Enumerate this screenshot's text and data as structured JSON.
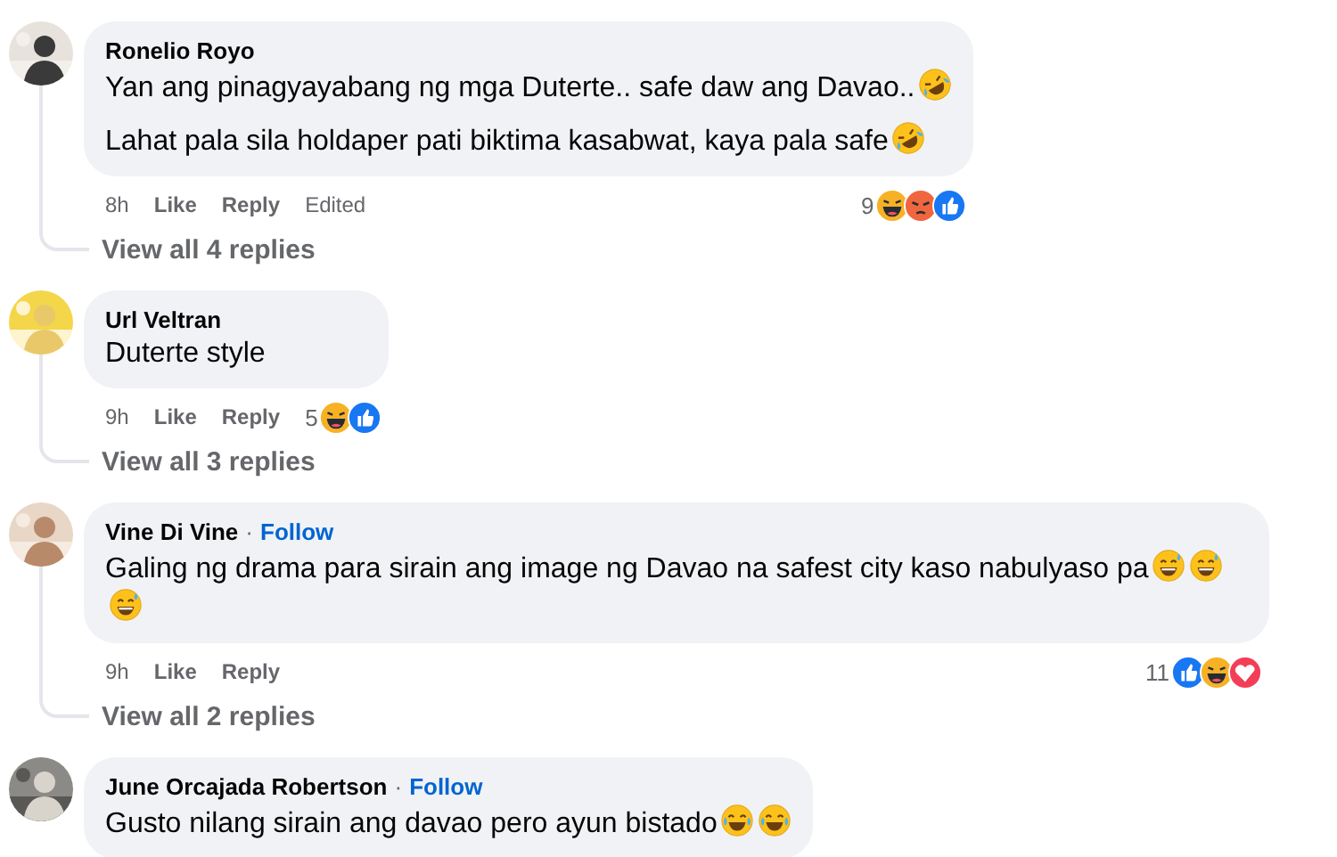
{
  "comments": [
    {
      "author": "Ronelio Royo",
      "paragraphs": [
        {
          "text": "Yan ang pinagyayabang ng mga Duterte.. safe daw ang Davao..",
          "emojis": [
            {
              "kind": "rofl"
            }
          ]
        },
        {
          "text": "Lahat pala sila holdaper pati biktima kasabwat, kaya pala safe",
          "emojis": [
            {
              "kind": "rofl"
            }
          ]
        }
      ],
      "time": "8h",
      "like": "Like",
      "reply": "Reply",
      "edited": "Edited",
      "reaction_count": "9",
      "reactions": [
        {
          "kind": "haha"
        },
        {
          "kind": "angry"
        },
        {
          "kind": "like"
        }
      ],
      "view_replies": "View all 4 replies"
    },
    {
      "author": "Url Veltran",
      "paragraphs": [
        {
          "text": "Duterte style"
        }
      ],
      "time": "9h",
      "like": "Like",
      "reply": "Reply",
      "reaction_count": "5",
      "reactions": [
        {
          "kind": "haha"
        },
        {
          "kind": "like"
        }
      ],
      "view_replies": "View all 3 replies"
    },
    {
      "author": "Vine Di Vine",
      "separator": "·",
      "follow": "Follow",
      "paragraphs": [
        {
          "text": "Galing ng drama para sirain ang image ng Davao na safest city kaso nabulyaso pa",
          "emojis": [
            {
              "kind": "sweat-smile"
            },
            {
              "kind": "sweat-smile"
            },
            {
              "kind": "sweat-smile"
            }
          ]
        }
      ],
      "time": "9h",
      "like": "Like",
      "reply": "Reply",
      "reaction_count": "11",
      "reactions": [
        {
          "kind": "like"
        },
        {
          "kind": "haha"
        },
        {
          "kind": "love"
        }
      ],
      "view_replies": "View all 2 replies"
    },
    {
      "author": "June Orcajada Robertson",
      "separator": "·",
      "follow": "Follow",
      "paragraphs": [
        {
          "text": "Gusto nilang sirain ang davao pero ayun bistado",
          "emojis": [
            {
              "kind": "joy"
            },
            {
              "kind": "joy"
            }
          ]
        }
      ]
    }
  ]
}
